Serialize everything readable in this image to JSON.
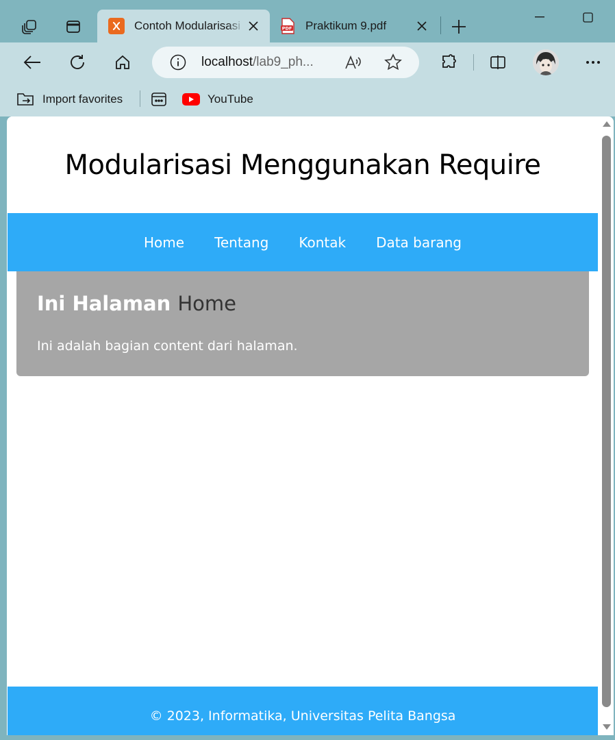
{
  "browser": {
    "tabs": [
      {
        "title": "Contoh Modularisasi",
        "active": true,
        "favicon": "xampp-icon"
      },
      {
        "title": "Praktikum 9.pdf",
        "active": false,
        "favicon": "pdf-icon"
      }
    ],
    "address": {
      "host": "localhost",
      "path": "/lab9_ph..."
    },
    "favorites": [
      {
        "label": "Import favorites",
        "icon": "import-favorites-icon"
      },
      {
        "label": "",
        "icon": "app-icon"
      },
      {
        "label": "YouTube",
        "icon": "youtube-icon"
      }
    ],
    "colors": {
      "frame": "#80b5be",
      "toolbar": "#c5dde2"
    }
  },
  "page": {
    "header_title": "Modularisasi Menggunakan Require",
    "nav": [
      "Home",
      "Tentang",
      "Kontak",
      "Data barang"
    ],
    "content_heading_prefix": "Ini Halaman",
    "content_heading_page": "Home",
    "content_text": "Ini adalah bagian content dari halaman.",
    "footer_text": "© 2023, Informatika, Universitas Pelita Bangsa",
    "colors": {
      "nav": "#2eabf8",
      "content": "#a6a6a6",
      "footer": "#2eabf8"
    }
  }
}
